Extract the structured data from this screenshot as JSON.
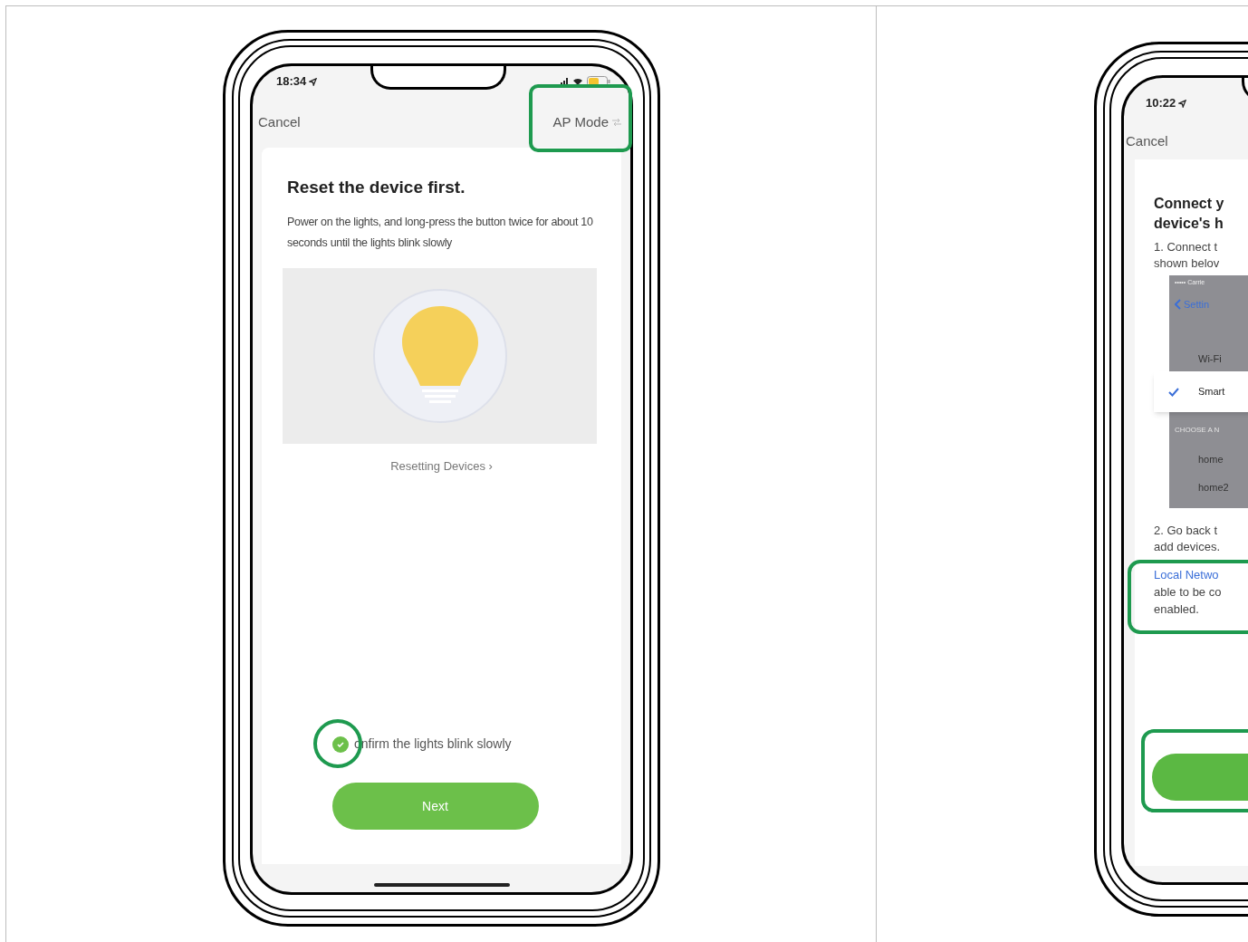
{
  "left_phone": {
    "status_bar": {
      "time": "18:34"
    },
    "nav": {
      "cancel": "Cancel",
      "mode": "AP Mode"
    },
    "title": "Reset the device first.",
    "description": "Power on the lights, and long-press the button twice for about 10 seconds until the lights blink slowly",
    "help_link": "Resetting Devices ›",
    "confirm": {
      "label": "onfirm the lights blink slowly",
      "checked": true
    },
    "next_button": "Next"
  },
  "right_phone": {
    "status_bar": {
      "time": "10:22"
    },
    "nav": {
      "cancel": "Cancel"
    },
    "title_lines": [
      "Connect y",
      "device's h"
    ],
    "step_1_lines": [
      "1. Connect t",
      "shown belov"
    ],
    "settings_shot": {
      "carrier": "••••• Carrie",
      "back": "Settin",
      "rows": [
        {
          "label": "Wi-Fi",
          "checked": false
        },
        {
          "label": "Smart",
          "checked": true
        }
      ],
      "section": "CHOOSE A N",
      "networks": [
        "home",
        "home2"
      ]
    },
    "step_2_lines": [
      "2. Go back t",
      "add devices."
    ],
    "note_link": "Local Netwo",
    "note_lines": [
      "able to be co",
      "enabled."
    ]
  }
}
